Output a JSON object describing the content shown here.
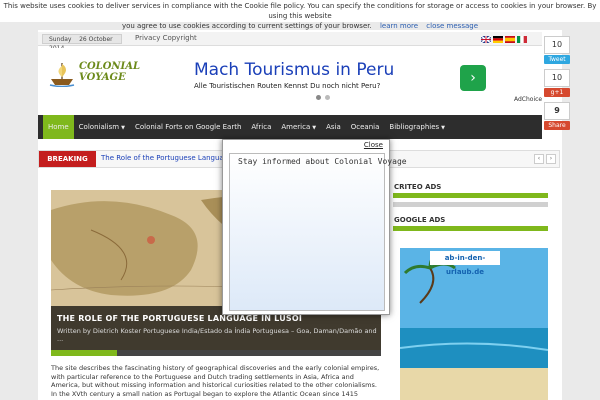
{
  "cookie_bar": {
    "line1": "This website uses cookies to deliver services in compliance with the Cookie file policy. You can specify the conditions for storage or access to cookies in your browser. By using this website",
    "line2": "you agree to use cookies according to current settings of your browser.",
    "learn_more": "learn more",
    "close": "close message"
  },
  "topbar": {
    "day": "Sunday",
    "date": "26 October 2014",
    "privacy": "Privacy Copyright"
  },
  "logo": {
    "line1": "COLONIAL",
    "line2": "VOYAGE"
  },
  "ad": {
    "title": "Mach Tourismus in Peru",
    "subtitle": "Alle Touristischen Routen Kennst Du noch nicht Peru?",
    "arrow": "›",
    "adchoice": "AdChoice"
  },
  "nav": [
    {
      "label": "Home",
      "caret": false
    },
    {
      "label": "Colonialism",
      "caret": true
    },
    {
      "label": "Colonial Forts on Google Earth",
      "caret": false
    },
    {
      "label": "Africa",
      "caret": false
    },
    {
      "label": "America",
      "caret": true
    },
    {
      "label": "Asia",
      "caret": false
    },
    {
      "label": "Oceania",
      "caret": false
    },
    {
      "label": "Bibliographies",
      "caret": true
    }
  ],
  "breaking": {
    "label": "BREAKING NEWS",
    "text": "The Role of the Portuguese Language",
    "prev": "‹",
    "next": "›"
  },
  "slide": {
    "title": "THE ROLE OF THE PORTUGUESE LANGUAGE IN LUSOI",
    "desc": "Written by Dietrich Koster Portuguese India/Estado da Índia Portuguesa – Goa, Daman/Damão and ...",
    "progress": 0.2
  },
  "body": {
    "p1": "The site describes the fascinating history of geographical discoveries and the early colonial empires, with particular reference to the Portuguese and Dutch trading settlements in Asia, Africa and America, but without missing information and historical curiosities related to the other colonialisms.",
    "p2": "In the XVth century a small nation as Portugal began to explore the Atlantic Ocean since 1415"
  },
  "sidebar": {
    "criteo": "CRITEO ADS",
    "google": "GOOGLE ADS",
    "ad_brand": "ab-in-den-urlaub.de"
  },
  "share": {
    "count1": "10",
    "tweet": "Tweet",
    "count2": "10",
    "gplus": "g+1",
    "count3": "9",
    "share": "Share"
  },
  "popup": {
    "text": "Stay informed about Colonial Voyage",
    "close": "Close"
  },
  "colors": {
    "accent": "#7fb81c",
    "nav_bg": "#2d2d2d",
    "breaking": "#c41e1e",
    "ad_link": "#1a3fb8"
  }
}
